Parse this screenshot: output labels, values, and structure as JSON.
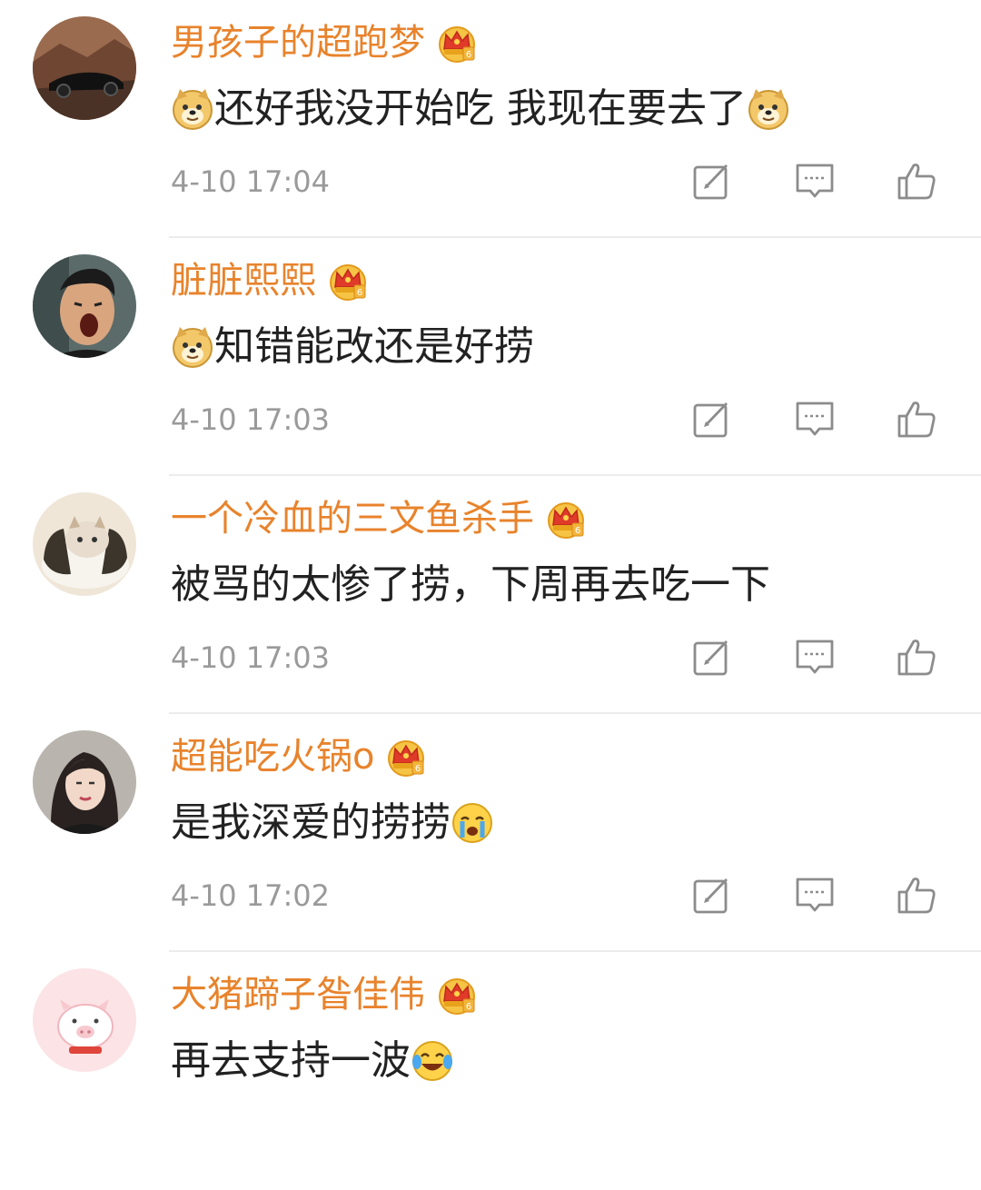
{
  "comments": [
    {
      "username": "男孩子的超跑梦",
      "avatar": "sports-car-avatar",
      "badge": "vip-crown-icon",
      "text": "还好我没开始吃 我现在要去了",
      "emojis": [
        "doge-emoji",
        "doge-emoji"
      ],
      "time": "4-10 17:04"
    },
    {
      "username": "脏脏熙熙",
      "avatar": "yawning-man-avatar",
      "badge": "vip-crown-icon",
      "text": "知错能改还是好捞",
      "emojis": [
        "doge-emoji"
      ],
      "time": "4-10 17:03"
    },
    {
      "username": "一个冷血的三文鱼杀手",
      "avatar": "cat-sushi-avatar",
      "badge": "vip-crown-icon",
      "text": "被骂的太惨了捞，下周再去吃一下",
      "emojis": [],
      "time": "4-10 17:03"
    },
    {
      "username": "超能吃火锅o",
      "avatar": "woman-portrait-avatar",
      "badge": "vip-crown-icon",
      "text": "是我深爱的捞捞",
      "emojis": [
        "crying-emoji"
      ],
      "time": "4-10 17:02"
    },
    {
      "username": "大猪蹄子昝佳伟",
      "avatar": "pink-pig-avatar",
      "badge": "vip-crown-icon",
      "text": "再去支持一波",
      "emojis": [
        "laugh-cry-emoji"
      ],
      "time": ""
    }
  ],
  "actions": {
    "repost_icon": "repost-icon",
    "comment_icon": "comment-icon",
    "like_icon": "like-icon"
  },
  "colors": {
    "username": "#e8832c",
    "text": "#222222",
    "time": "#9a9a9a",
    "divider": "#ececec"
  }
}
